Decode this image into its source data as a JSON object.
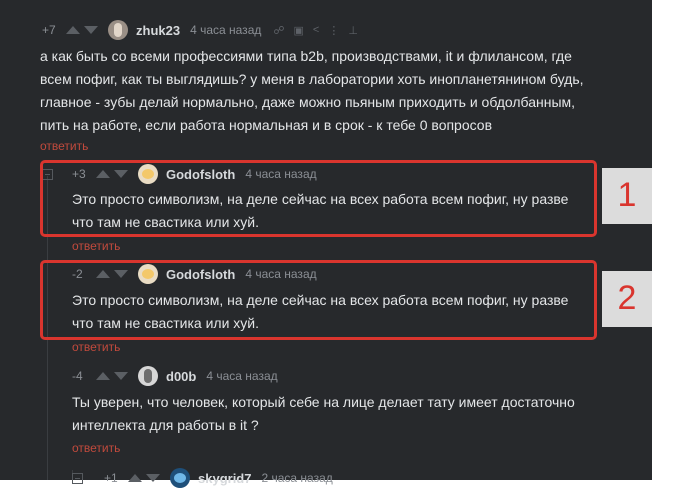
{
  "comments": [
    {
      "score": "+7",
      "author": "zhuk23",
      "time": "4 часа назад",
      "text_lines": [
        "а как быть со всеми профессиями типа b2b, производствами, it и флилансом, где",
        "всем пофиг, как ты выглядишь? у меня в лаборатории хоть инопланетянином будь,",
        "главное - зубы делай нормально, даже можно пьяным приходить и обдолбанным,",
        "пить на работе, если работа нормальная и в срок - к тебе 0 вопросов"
      ],
      "reply": "ответить"
    },
    {
      "score": "+3",
      "author": "Godofsloth",
      "time": "4 часа назад",
      "text_lines": [
        "Это просто символизм, на деле сейчас на всех работа всем пофиг, ну разве",
        "что там не свастика или хуй."
      ],
      "reply": "ответить"
    },
    {
      "score": "-2",
      "author": "Godofsloth",
      "time": "4 часа назад",
      "text_lines": [
        "Это просто символизм, на деле сейчас на всех работа всем пофиг, ну разве",
        "что там не свастика или хуй."
      ],
      "reply": "ответить"
    },
    {
      "score": "-4",
      "author": "d00b",
      "time": "4 часа назад",
      "text_lines": [
        "Ты уверен, что человек, который себе на лице делает тату имеет достаточно",
        "интеллекта для работы в it ?"
      ],
      "reply": "ответить"
    },
    {
      "score": "+1",
      "author": "skygrid7",
      "time": "2 часа назад"
    }
  ],
  "annotations": [
    "1",
    "2"
  ],
  "colors": {
    "panel": "#27292c",
    "highlight": "#d9352e",
    "link": "#c24a3d"
  }
}
